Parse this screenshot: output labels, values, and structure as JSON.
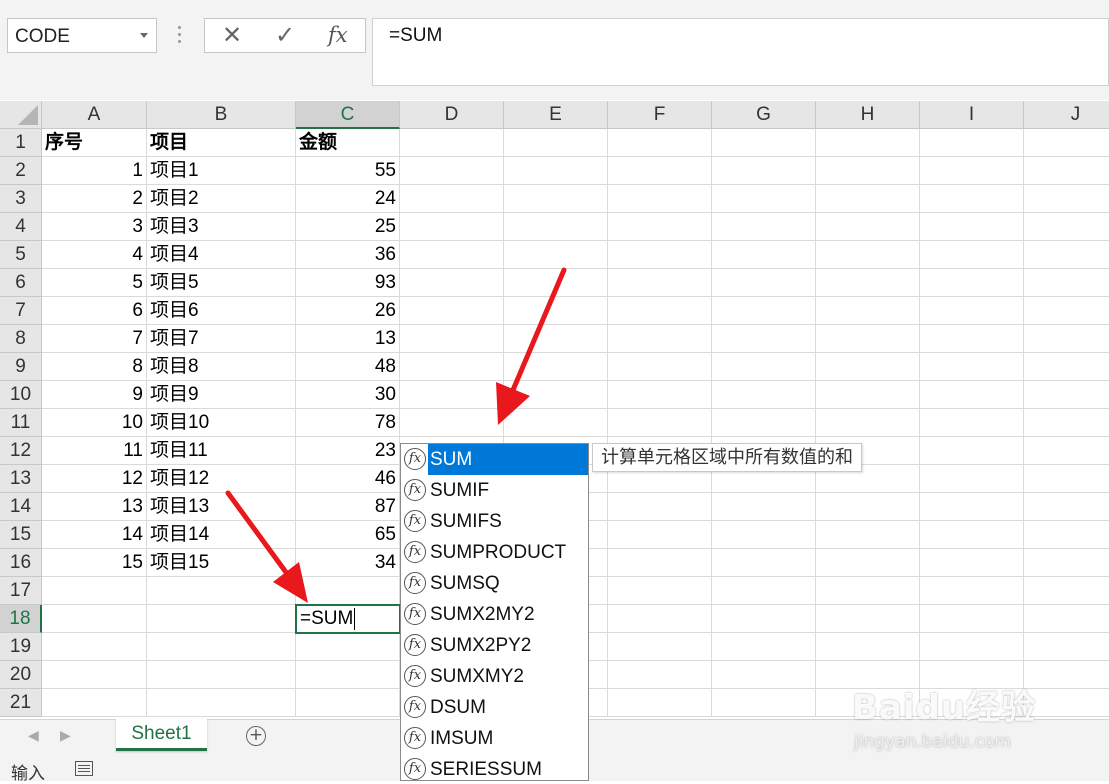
{
  "name_box": "CODE",
  "formula_bar": {
    "cancel_icon": "✕",
    "enter_icon": "✓",
    "fx_label": "fx",
    "content": "=SUM"
  },
  "columns": [
    "A",
    "B",
    "C",
    "D",
    "E",
    "F",
    "G",
    "H",
    "I",
    "J"
  ],
  "selected_column": "C",
  "rows": [
    "1",
    "2",
    "3",
    "4",
    "5",
    "6",
    "7",
    "8",
    "9",
    "10",
    "11",
    "12",
    "13",
    "14",
    "15",
    "16",
    "17",
    "18",
    "19",
    "20",
    "21"
  ],
  "selected_row": "18",
  "headers": {
    "a": "序号",
    "b": "项目",
    "c": "金额"
  },
  "data": [
    {
      "a": "1",
      "b": "项目1",
      "c": "55"
    },
    {
      "a": "2",
      "b": "项目2",
      "c": "24"
    },
    {
      "a": "3",
      "b": "项目3",
      "c": "25"
    },
    {
      "a": "4",
      "b": "项目4",
      "c": "36"
    },
    {
      "a": "5",
      "b": "项目5",
      "c": "93"
    },
    {
      "a": "6",
      "b": "项目6",
      "c": "26"
    },
    {
      "a": "7",
      "b": "项目7",
      "c": "13"
    },
    {
      "a": "8",
      "b": "项目8",
      "c": "48"
    },
    {
      "a": "9",
      "b": "项目9",
      "c": "30"
    },
    {
      "a": "10",
      "b": "项目10",
      "c": "78"
    },
    {
      "a": "11",
      "b": "项目11",
      "c": "23"
    },
    {
      "a": "12",
      "b": "项目12",
      "c": "46"
    },
    {
      "a": "13",
      "b": "项目13",
      "c": "87"
    },
    {
      "a": "14",
      "b": "项目14",
      "c": "65"
    },
    {
      "a": "15",
      "b": "项目15",
      "c": "34"
    }
  ],
  "active_cell_value": "=SUM",
  "autocomplete": {
    "items": [
      "SUM",
      "SUMIF",
      "SUMIFS",
      "SUMPRODUCT",
      "SUMSQ",
      "SUMX2MY2",
      "SUMX2PY2",
      "SUMXMY2",
      "DSUM",
      "IMSUM",
      "SERIESSUM"
    ],
    "selected": "SUM",
    "tooltip": "计算单元格区域中所有数值的和",
    "icon_label": "fx"
  },
  "sheet_tabs": [
    "Sheet1"
  ],
  "add_sheet_icon": "+",
  "status_mode": "输入",
  "watermark": {
    "brand": "Baidu经验",
    "url": "jingyan.baidu.com"
  },
  "colors": {
    "excel_green": "#217346",
    "highlight_blue": "#0078d7",
    "arrow_red": "#e8181c"
  }
}
